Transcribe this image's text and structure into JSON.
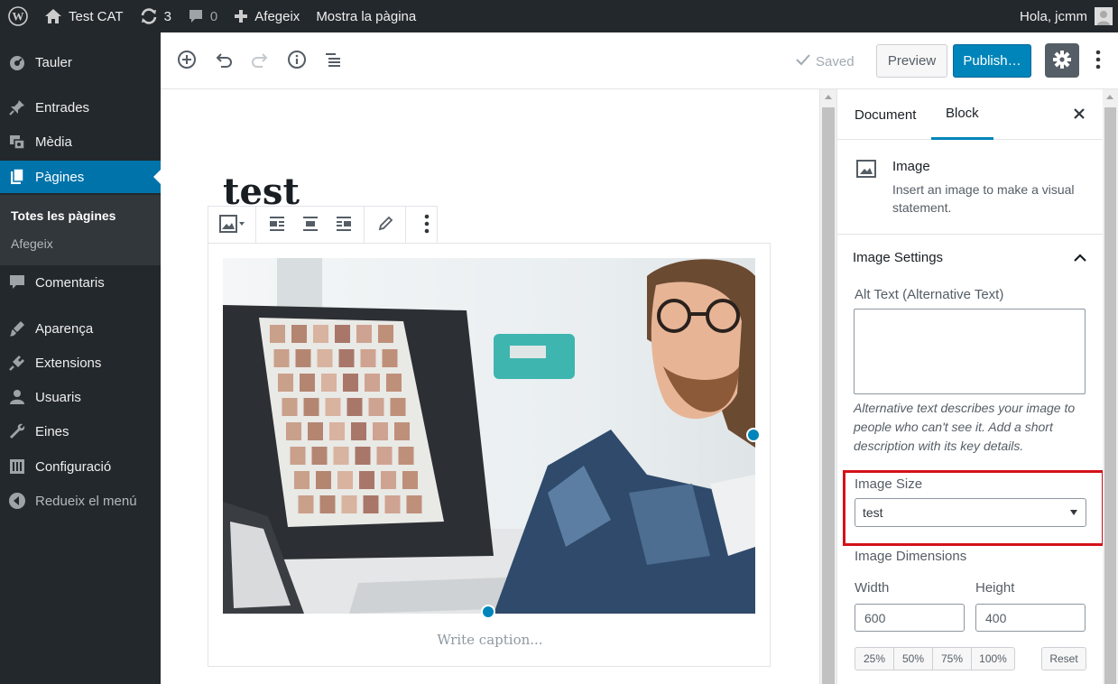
{
  "adminbar": {
    "site_name": "Test CAT",
    "updates_count": "3",
    "comments_count": "0",
    "add_new": "Afegeix",
    "view_page": "Mostra la pàgina",
    "greeting": "Hola, jcmm"
  },
  "sidebar": {
    "items": [
      {
        "label": "Tauler",
        "icon": "dashboard-icon"
      },
      {
        "label": "Entrades",
        "icon": "pin-icon"
      },
      {
        "label": "Mèdia",
        "icon": "media-icon"
      },
      {
        "label": "Pàgines",
        "icon": "pages-icon"
      },
      {
        "label": "Comentaris",
        "icon": "comment-icon"
      },
      {
        "label": "Aparença",
        "icon": "appearance-icon"
      },
      {
        "label": "Extensions",
        "icon": "plugin-icon"
      },
      {
        "label": "Usuaris",
        "icon": "users-icon"
      },
      {
        "label": "Eines",
        "icon": "wrench-icon"
      },
      {
        "label": "Configuració",
        "icon": "settings-icon"
      },
      {
        "label": "Redueix el menú",
        "icon": "collapse-icon"
      }
    ],
    "submenu": {
      "current": "Totes les pàgines",
      "add": "Afegeix"
    }
  },
  "header": {
    "saved": "Saved",
    "preview": "Preview",
    "publish": "Publish…"
  },
  "editor": {
    "title": "test",
    "caption_placeholder": "Write caption..."
  },
  "panel": {
    "tabs": [
      "Document",
      "Block"
    ],
    "active_tab": "Block",
    "block_name": "Image",
    "block_description": "Insert an image to make a visual statement.",
    "section_title": "Image Settings",
    "alt_label": "Alt Text (Alternative Text)",
    "alt_value": "",
    "alt_help": "Alternative text describes your image to people who can't see it. Add a short description with its key details.",
    "size_label": "Image Size",
    "size_value": "test",
    "dimensions_label": "Image Dimensions",
    "width_label": "Width",
    "height_label": "Height",
    "width_value": "600",
    "height_value": "400",
    "percent_buttons": [
      "25%",
      "50%",
      "75%",
      "100%"
    ],
    "reset": "Reset"
  },
  "colors": {
    "admin_bg": "#23282d",
    "accent": "#0085ba",
    "active_menu": "#0073aa",
    "highlight": "#d4111a"
  }
}
